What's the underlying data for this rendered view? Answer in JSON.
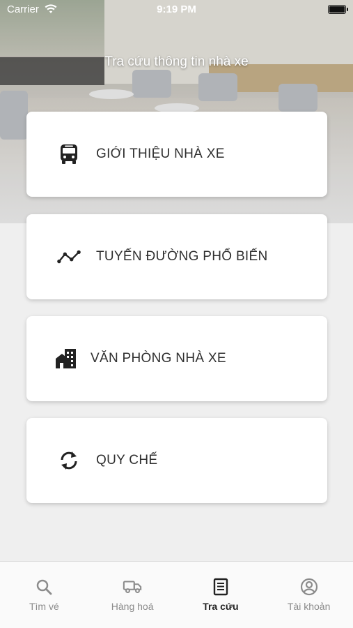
{
  "status_bar": {
    "carrier": "Carrier",
    "time": "9:19 PM"
  },
  "header": {
    "title": "Tra cứu thông tin nhà xe"
  },
  "menu": [
    {
      "label": "GIỚI THIỆU NHÀ XE",
      "icon": "bus-icon"
    },
    {
      "label": "TUYẾN ĐƯỜNG PHỔ BIẾN",
      "icon": "route-line-icon"
    },
    {
      "label": "VĂN PHÒNG NHÀ XE",
      "icon": "office-building-icon"
    },
    {
      "label": "QUY CHẾ",
      "icon": "sync-icon"
    }
  ],
  "tabs": [
    {
      "label": "Tìm vé",
      "icon": "search-icon",
      "active": false
    },
    {
      "label": "Hàng hoá",
      "icon": "truck-icon",
      "active": false
    },
    {
      "label": "Tra cứu",
      "icon": "receipt-icon",
      "active": true
    },
    {
      "label": "Tài khoản",
      "icon": "account-icon",
      "active": false
    }
  ],
  "colors": {
    "active_tab": "#222222",
    "inactive_tab": "#8b8b8b",
    "background": "#efefef"
  }
}
